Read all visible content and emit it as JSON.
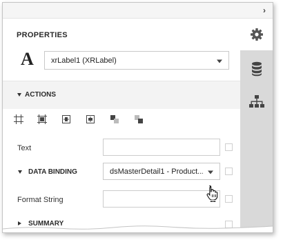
{
  "panel": {
    "title": "PROPERTIES",
    "control_glyph": "A",
    "control_select": {
      "value": "xrLabel1 (XRLabel)"
    }
  },
  "actions": {
    "header": "ACTIONS",
    "toolbar_icons": [
      "align-to-grid-icon",
      "size-to-grid-icon",
      "center-horizontally-icon",
      "center-vertically-icon",
      "bring-to-front-icon",
      "send-to-back-icon"
    ]
  },
  "properties": {
    "text_label": "Text",
    "text_value": "",
    "data_binding_label": "DATA BINDING",
    "data_binding_value": "dsMasterDetail1 - Product...",
    "format_string_label": "Format String",
    "format_string_value": "",
    "ellipsis": "...",
    "summary_label": "SUMMARY"
  },
  "side_tabs": [
    "gear-icon",
    "database-icon",
    "report-explorer-icon"
  ],
  "colors": {
    "sidebar": "#d9d9d9",
    "section_header": "#f3f3f3",
    "border": "#c8c8c8"
  }
}
